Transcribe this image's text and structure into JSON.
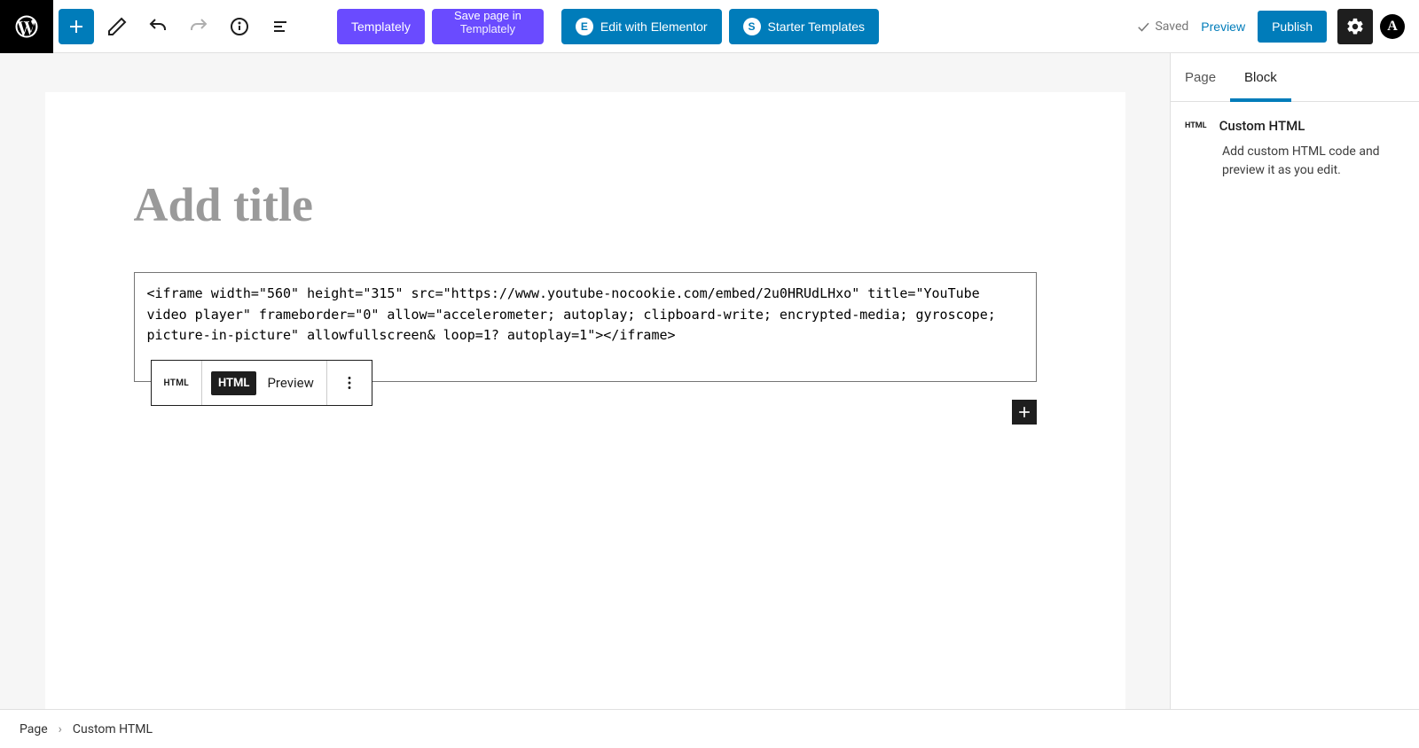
{
  "toolbar": {
    "templately_label": "Templately",
    "save_page_line1": "Save page in",
    "save_page_line2": "Templately",
    "edit_elementor": "Edit with Elementor",
    "starter_templates": "Starter Templates",
    "saved_label": "Saved",
    "preview_label": "Preview",
    "publish_label": "Publish"
  },
  "editor": {
    "title_placeholder": "Add title",
    "block_toolbar": {
      "type_label": "HTML",
      "html_chip": "HTML",
      "preview_label": "Preview"
    },
    "html_code": "<iframe width=\"560\" height=\"315\" src=\"https://www.youtube-nocookie.com/embed/2u0HRUdLHxo\" title=\"YouTube video player\" frameborder=\"0\" allow=\"accelerometer; autoplay; clipboard-write; encrypted-media; gyroscope; picture-in-picture\" allowfullscreen& loop=1? autoplay=1\"></iframe>"
  },
  "sidebar": {
    "tab_page": "Page",
    "tab_block": "Block",
    "block_type_badge": "HTML",
    "block_title": "Custom HTML",
    "block_desc": "Add custom HTML code and preview it as you edit."
  },
  "breadcrumb": {
    "root": "Page",
    "current": "Custom HTML"
  }
}
